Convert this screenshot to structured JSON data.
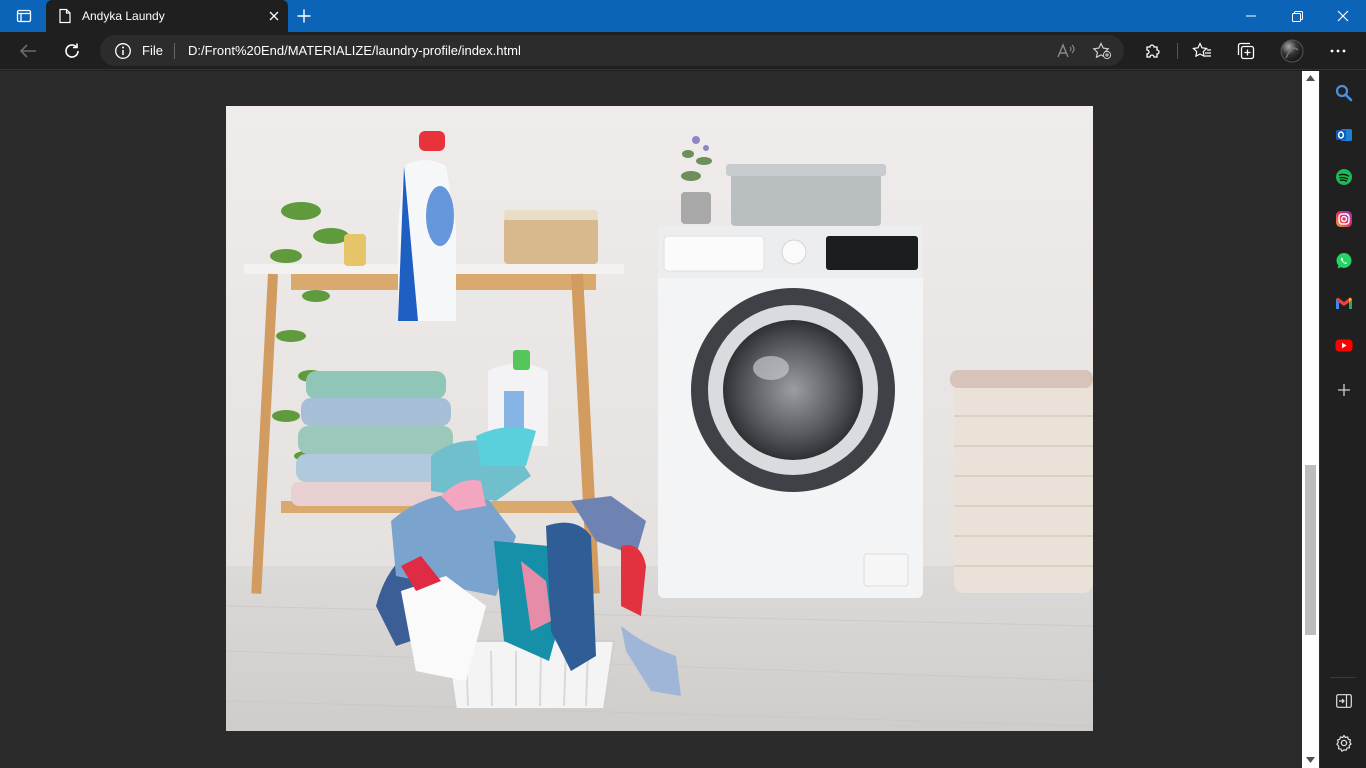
{
  "browser": {
    "tab": {
      "title": "Andyka Laundy",
      "icon": "page-icon"
    },
    "address": {
      "scheme": "File",
      "url": "D:/Front%20End/MATERIALIZE/laundry-profile/index.html"
    },
    "colors": {
      "titlebar": "#0b64b7",
      "toolbar": "#1f1f1f",
      "page_background": "#2b2b2b"
    }
  },
  "page": {
    "hero_image": {
      "subject": "laundry room with washing machine and basket of clothes"
    }
  },
  "sidebar": {
    "apps": [
      "search-icon",
      "outlook-icon",
      "spotify-icon",
      "instagram-icon",
      "whatsapp-icon",
      "gmail-icon",
      "youtube-icon",
      "add-icon"
    ],
    "bottom": [
      "hide-sidebar-icon",
      "settings-icon"
    ]
  }
}
